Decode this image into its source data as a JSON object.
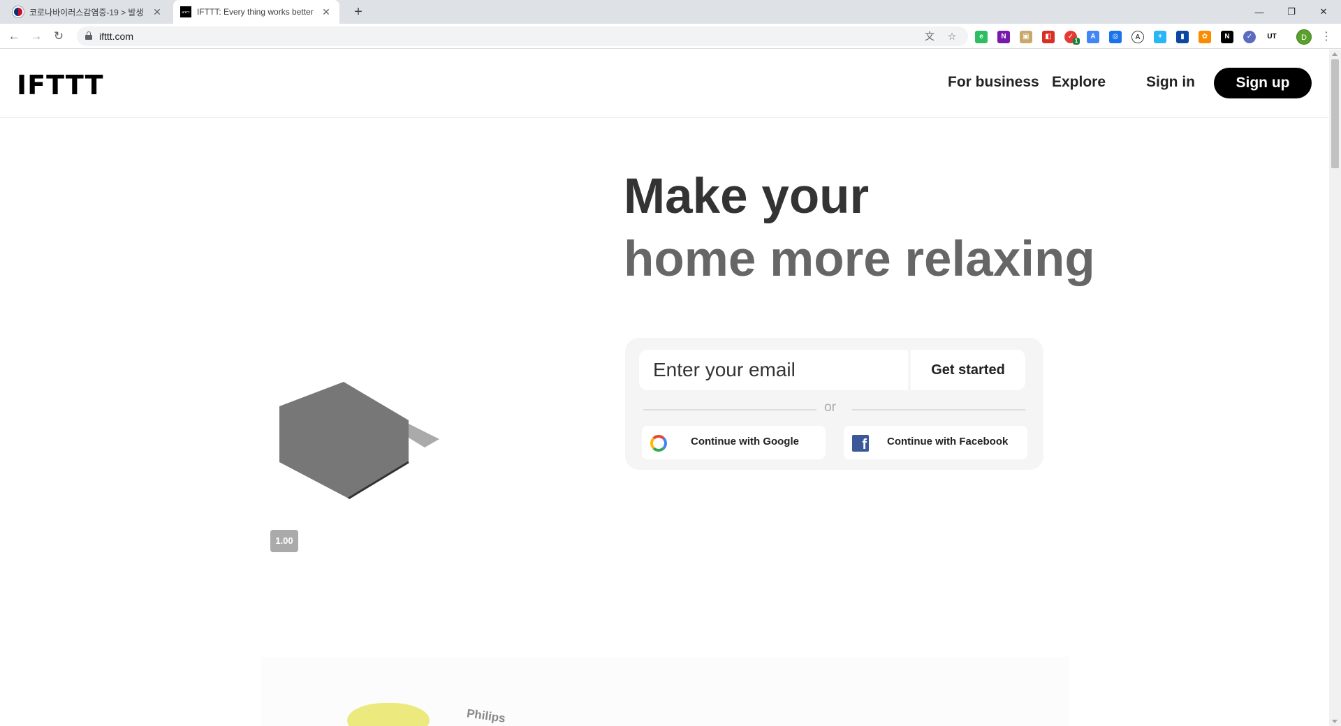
{
  "browser": {
    "tabs": [
      {
        "title": "코로나바이러스감염증-19 > 발생",
        "active": false
      },
      {
        "title": "IFTTT: Every thing works better",
        "active": true
      }
    ],
    "url": "ifttt.com",
    "profile_initial": "D",
    "extension_badge": "1"
  },
  "site": {
    "logo": "IFTTT",
    "nav": {
      "for_business": "For business",
      "explore": "Explore",
      "sign_in": "Sign in",
      "sign_up": "Sign up"
    },
    "hero": {
      "line1": "Make your",
      "line2": "home more relaxing"
    },
    "signup_form": {
      "email_placeholder": "Enter your email",
      "get_started": "Get started",
      "or": "or",
      "google": "Continue with Google",
      "facebook": "Continue with Facebook"
    },
    "zoom_badge": "1.00",
    "bottom_label": "Philips"
  },
  "colors": {
    "brand_black": "#000000",
    "card_bg": "#f5f5f5",
    "facebook_blue": "#3b5998",
    "hex_gray": "#777777"
  }
}
